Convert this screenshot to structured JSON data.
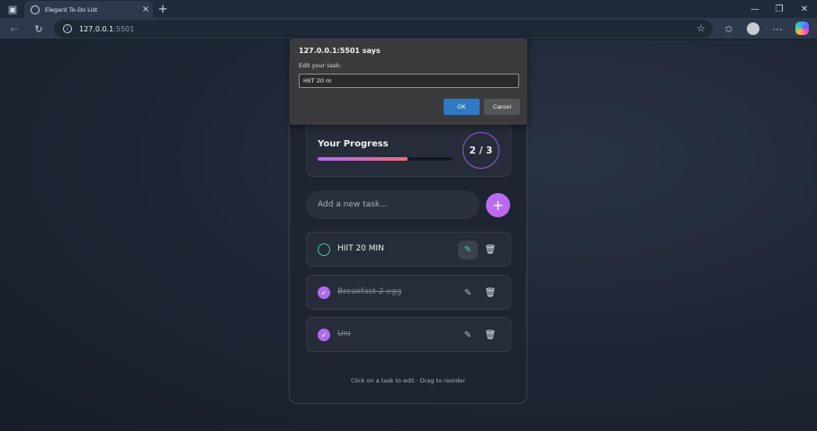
{
  "browser": {
    "tab_title": "Elegant To-Do List",
    "url_host": "127.0.0.1",
    "url_port": ":5501"
  },
  "progress": {
    "title": "Your Progress",
    "count": "2 / 3",
    "fraction": 0.667
  },
  "add_task": {
    "placeholder": "Add a new task...",
    "button": "+"
  },
  "tasks": [
    {
      "label": "HIIT 20 MIN",
      "done": false
    },
    {
      "label": "Breakfast 2 egg",
      "done": true
    },
    {
      "label": "Uni",
      "done": true
    }
  ],
  "hint": "Click on a task to edit · Drag to reorder",
  "dialog": {
    "title": "127.0.0.1:5501 says",
    "message": "Edit your task:",
    "value": "HIIT 20 m",
    "ok": "OK",
    "cancel": "Cancel"
  },
  "colors": {
    "accent": "#b86af2",
    "check_open": "#38c4b4",
    "dialog_ok": "#2f78c4"
  }
}
